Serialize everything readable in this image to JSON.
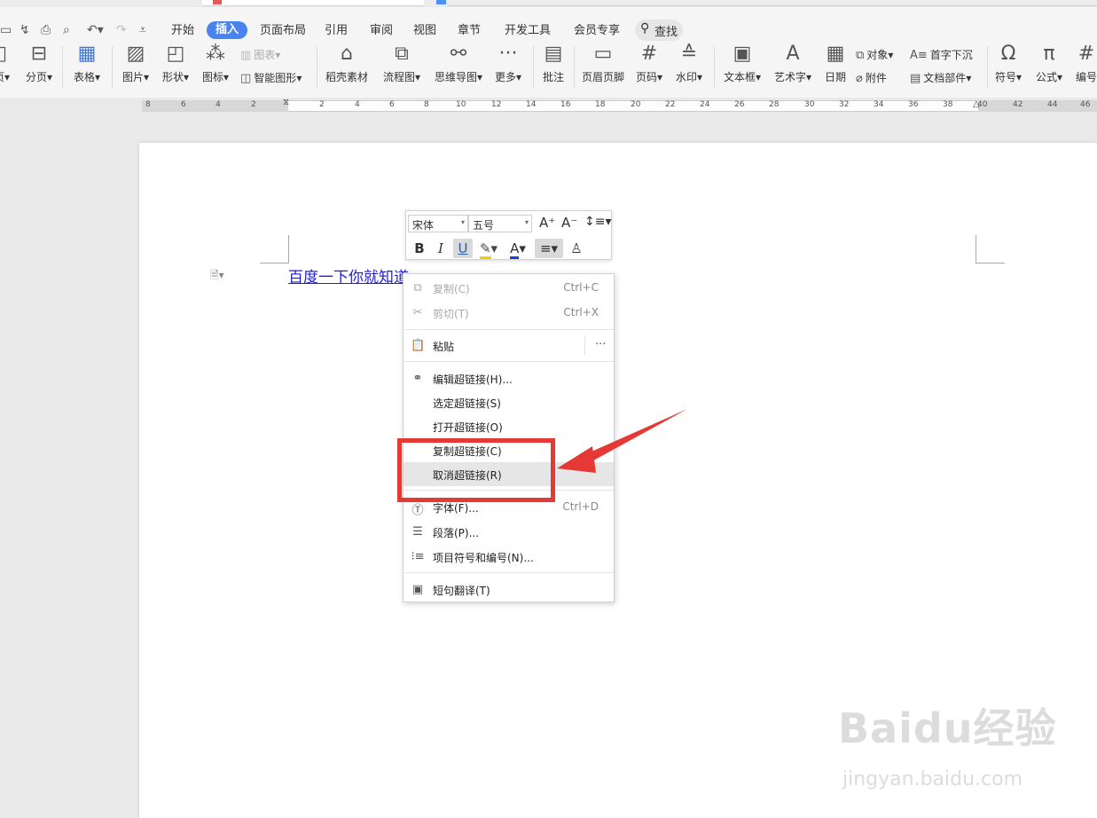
{
  "menubar": {
    "tabs": [
      "开始",
      "插入",
      "页面布局",
      "引用",
      "审阅",
      "视图",
      "章节",
      "开发工具",
      "会员专享"
    ],
    "search": "查找"
  },
  "ribbon": {
    "fenye": "分页",
    "biaoge": "表格",
    "tupian": "图片",
    "xingzhuang": "形状",
    "tubiao": "图标",
    "tubiao2": "图表",
    "zhinengtuxing": "智能图形",
    "daokesucai": "稻壳素材",
    "liuchengtu": "流程图",
    "siweidaotu": "思维导图",
    "gengduo": "更多",
    "pizhu": "批注",
    "yemeiyejiao": "页眉页脚",
    "yema": "页码",
    "shuiyin": "水印",
    "wenbenkuang": "文本框",
    "yishuzi": "艺术字",
    "riqi": "日期",
    "duixiang": "对象",
    "fujian": "附件",
    "shouzixiachen": "首字下沉",
    "wendangbujian": "文档部件",
    "fuhao": "符号",
    "gongshi": "公式",
    "bianhao": "编号"
  },
  "ruler": {
    "left_numbers": [
      "8",
      "6",
      "4",
      "2"
    ],
    "right_numbers": [
      "2",
      "4",
      "6",
      "8",
      "10",
      "12",
      "14",
      "16",
      "18",
      "20",
      "22",
      "24",
      "26",
      "28",
      "30",
      "32",
      "34",
      "36",
      "38",
      "40",
      "42",
      "44",
      "46"
    ]
  },
  "document": {
    "hyperlink_text": "百度一下你就知道"
  },
  "minitoolbar": {
    "font": "宋体",
    "size": "五号"
  },
  "context_menu": {
    "copy": "复制(C)",
    "copy_shortcut": "Ctrl+C",
    "cut": "剪切(T)",
    "cut_shortcut": "Ctrl+X",
    "paste": "粘贴",
    "edit_link": "编辑超链接(H)...",
    "select_link": "选定超链接(S)",
    "open_link": "打开超链接(O)",
    "copy_link": "复制超链接(C)",
    "remove_link": "取消超链接(R)",
    "font": "字体(F)...",
    "font_shortcut": "Ctrl+D",
    "paragraph": "段落(P)...",
    "bullets": "项目符号和编号(N)...",
    "translate": "短句翻译(T)"
  },
  "watermark": {
    "logo": "Baidu经验",
    "url": "jingyan.baidu.com"
  },
  "colors": {
    "accent": "#4a82f0",
    "highlight_box": "#e53935",
    "link": "#1f1fd6"
  }
}
